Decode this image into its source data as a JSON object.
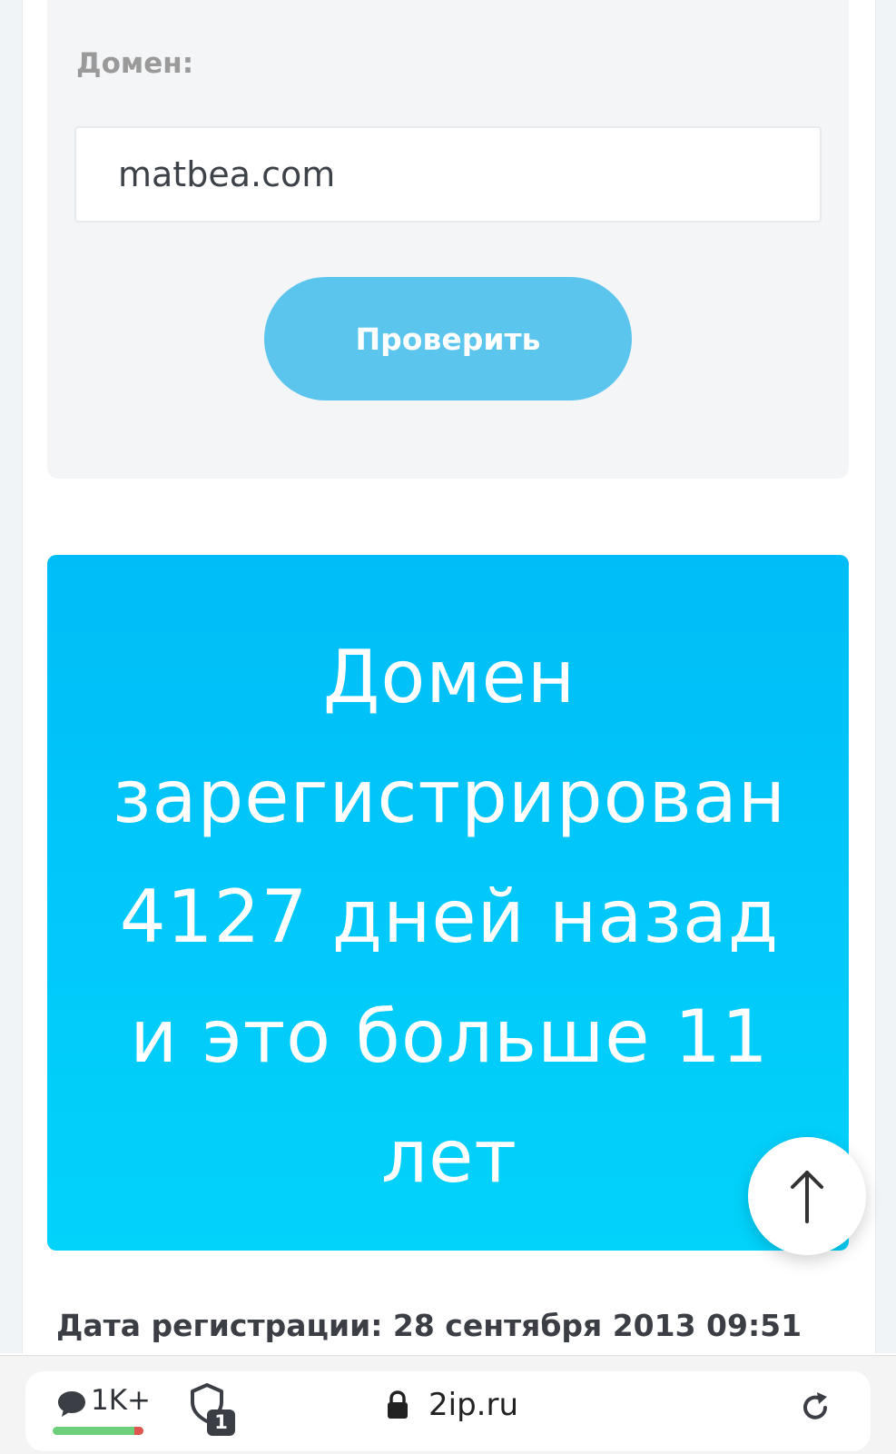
{
  "form": {
    "label": "Домен:",
    "input_value": "matbea.com",
    "button_label": "Проверить"
  },
  "result": {
    "line1": "Домен",
    "line2": "зарегистрирован",
    "line3": "4127 дней назад",
    "line4": "и это больше 11",
    "line5": "лет"
  },
  "registration": {
    "text": "Дата регистрации: 28 сентября 2013 09:51"
  },
  "browser_bar": {
    "comments_count": "1K+",
    "tabs_badge": "1",
    "url": "2ip.ru",
    "health_bad_fraction": 0.1
  },
  "colors": {
    "button": "#5bc5ee",
    "banner_top": "#00bdf8",
    "banner_bottom": "#02d3fb"
  },
  "icons": [
    "arrow-up-icon",
    "comment-bubble-icon",
    "shield-icon",
    "lock-icon",
    "reload-icon"
  ]
}
